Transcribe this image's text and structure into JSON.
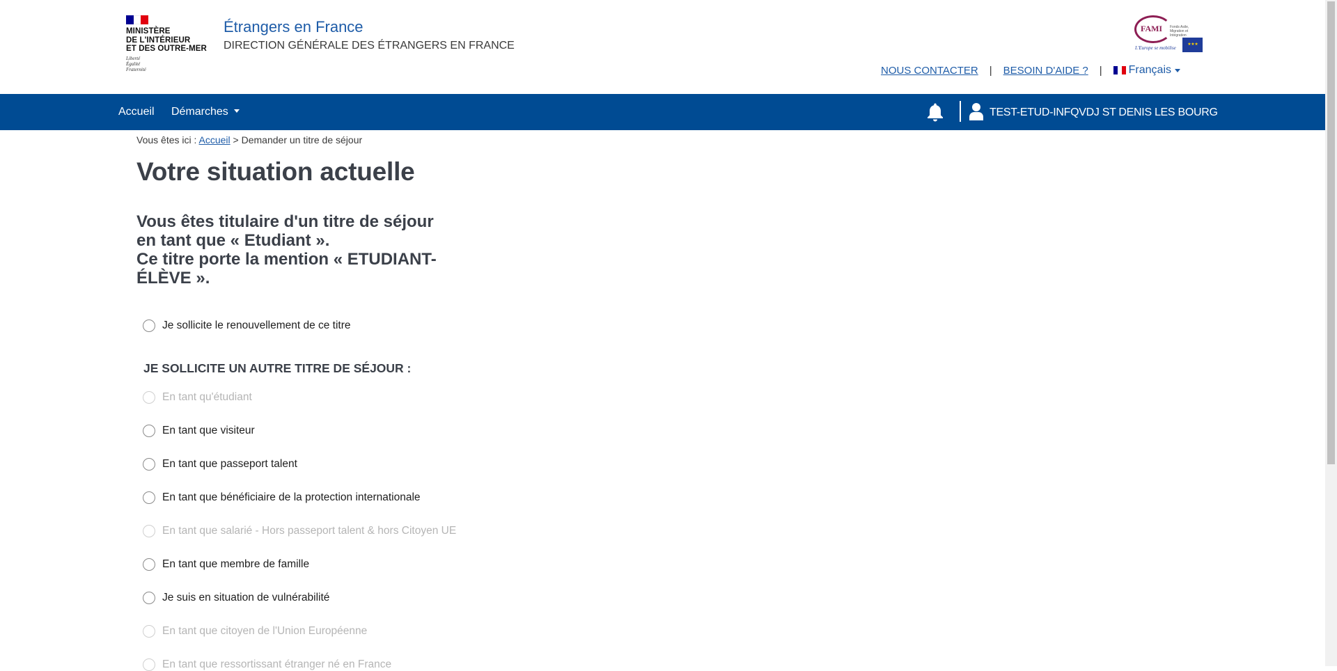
{
  "colors": {
    "brand_blue": "#004b93",
    "link_blue": "#1e5ca8",
    "heading": "#3b4049",
    "fami": "#8d1e54",
    "disabled": "#b5b5b5"
  },
  "header": {
    "ministry_lines": [
      "MINISTÈRE",
      "DE L'INTÉRIEUR",
      "ET DES OUTRE-MER"
    ],
    "motto": [
      "Liberté",
      "Égalité",
      "Fraternité"
    ],
    "site_title": "Étrangers en France",
    "site_subtitle": "DIRECTION GÉNÉRALE DES ÉTRANGERS EN FRANCE",
    "fami": {
      "word": "FAMI",
      "small": "Fonds Asile, Migration et Intégration",
      "eu": "★ ★ ★",
      "slogan": "L'Europe se mobilise"
    },
    "links": {
      "contact": "NOUS CONTACTER",
      "help": "BESOIN D'AIDE ?",
      "separator": "|",
      "language": "Français"
    }
  },
  "nav": {
    "home": "Accueil",
    "procedures": "Démarches",
    "icons": {
      "notifications": "bell-icon",
      "account": "user-icon"
    },
    "user": "TEST-ETUD-INFQVDJ ST DENIS LES BOURG"
  },
  "breadcrumb": {
    "prefix": "Vous êtes ici :",
    "home": "Accueil",
    "current": "> Demander un titre de séjour"
  },
  "page": {
    "title": "Votre situation actuelle",
    "situation_line1": "Vous êtes titulaire d'un titre de séjour en tant que « Etudiant ».",
    "situation_line2": "Ce titre porte la mention « ETUDIANT-ÉLÈVE ».",
    "renewal_option": "Je sollicite le renouvellement de ce titre",
    "other_title_heading": "JE SOLLICITE UN AUTRE TITRE DE SÉJOUR :",
    "options": [
      {
        "label": "En tant qu'étudiant",
        "disabled": true
      },
      {
        "label": "En tant que visiteur",
        "disabled": false
      },
      {
        "label": "En tant que passeport talent",
        "disabled": false
      },
      {
        "label": "En tant que bénéficiaire de la protection internationale",
        "disabled": false
      },
      {
        "label": "En tant que salarié - Hors passeport talent & hors Citoyen UE",
        "disabled": true
      },
      {
        "label": "En tant que membre de famille",
        "disabled": false
      },
      {
        "label": "Je suis en situation de vulnérabilité",
        "disabled": false
      },
      {
        "label": "En tant que citoyen de l'Union Européenne",
        "disabled": true
      },
      {
        "label": "En tant que ressortissant étranger né en France",
        "disabled": true
      }
    ]
  }
}
